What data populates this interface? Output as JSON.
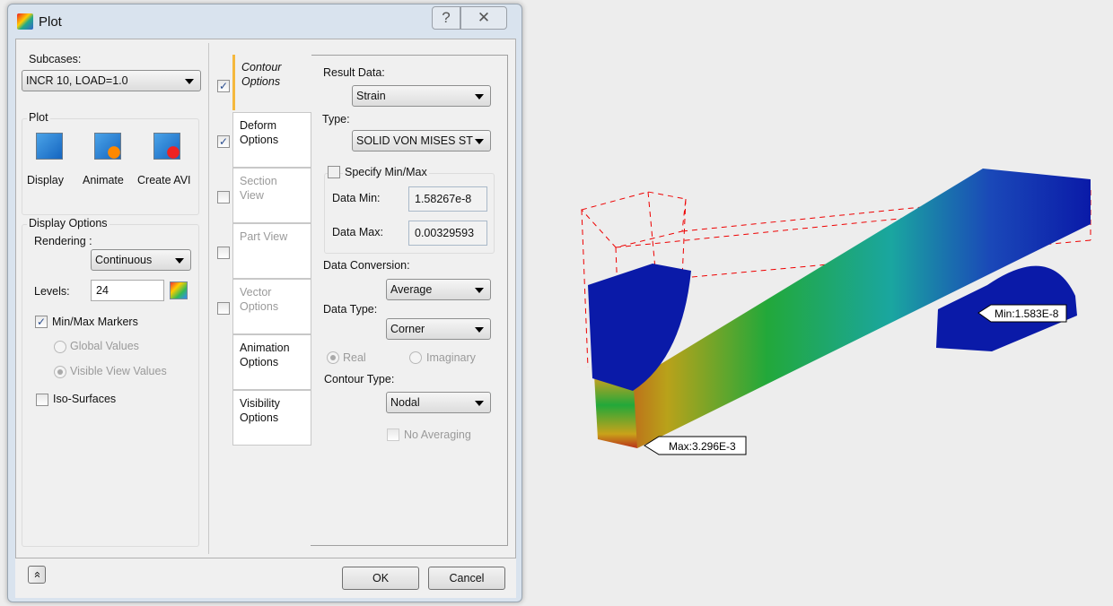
{
  "window": {
    "title": "Plot",
    "help": "?",
    "close": "✕"
  },
  "subcases": {
    "label": "Subcases:",
    "value": "INCR 10, LOAD=1.0"
  },
  "plot": {
    "label": "Plot",
    "display": "Display",
    "animate": "Animate",
    "create_avi": "Create AVI"
  },
  "display_options": {
    "label": "Display Options",
    "rendering_label": "Rendering :",
    "rendering_value": "Continuous",
    "levels_label": "Levels:",
    "levels_value": "24",
    "minmax_markers": "Min/Max Markers",
    "global_values": "Global Values",
    "visible_view_values": "Visible View Values",
    "iso_surfaces": "Iso-Surfaces"
  },
  "tabs": [
    {
      "label": "Contour Options",
      "checked": true
    },
    {
      "label": "Deform Options",
      "checked": true
    },
    {
      "label": "Section View",
      "checked": false
    },
    {
      "label": "Part View",
      "checked": false
    },
    {
      "label": "Vector Options",
      "checked": false
    },
    {
      "label": "Animation Options"
    },
    {
      "label": "Visibility Options"
    }
  ],
  "contour": {
    "result_data_label": "Result Data:",
    "result_data_value": "Strain",
    "type_label": "Type:",
    "type_value": "SOLID VON MISES ST",
    "specify_minmax": "Specify Min/Max",
    "data_min_label": "Data Min:",
    "data_min_value": "1.58267e-8",
    "data_max_label": "Data Max:",
    "data_max_value": "0.00329593",
    "conversion_label": "Data Conversion:",
    "conversion_value": "Average",
    "data_type_label": "Data Type:",
    "data_type_value": "Corner",
    "real": "Real",
    "imaginary": "Imaginary",
    "contour_type_label": "Contour Type:",
    "contour_type_value": "Nodal",
    "no_averaging": "No Averaging"
  },
  "footer": {
    "ok": "OK",
    "cancel": "Cancel",
    "expand": "»"
  },
  "viewport": {
    "max_label": "Max:3.296E-3",
    "min_label": "Min:1.583E-8"
  },
  "colors": {
    "accent": "#f5b83d",
    "model_blue": "#0a1aa8"
  }
}
